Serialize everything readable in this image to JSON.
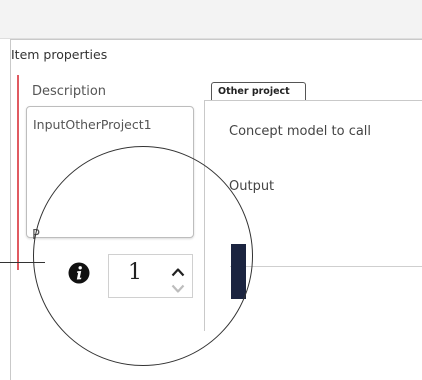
{
  "panel": {
    "title": "Item properties",
    "description_label": "Description",
    "description_value": "InputOtherProject1",
    "truncated_label": "P"
  },
  "tab": {
    "label": "Other project",
    "fields": [
      {
        "label": "Concept model to call"
      },
      {
        "label": "Output"
      }
    ]
  },
  "magnified": {
    "info_icon": "info-circle-icon",
    "stepper_value": "1",
    "up_icon": "chevron-up-icon",
    "down_icon": "chevron-down-icon"
  },
  "colors": {
    "accent_red": "#e05a61",
    "dark_navy": "#1b2440"
  }
}
